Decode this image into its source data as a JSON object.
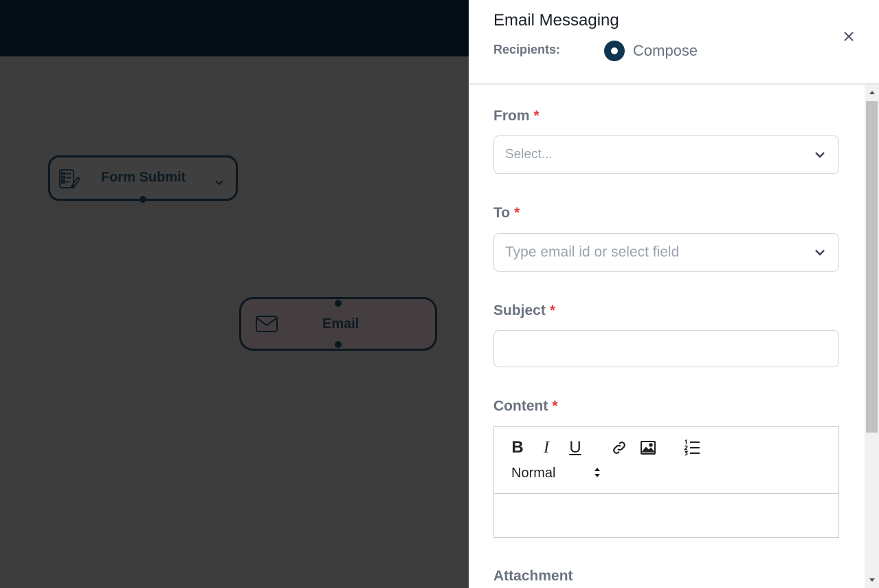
{
  "canvas": {
    "nodes": [
      {
        "label": "Form Submit",
        "icon": "form-icon"
      },
      {
        "label": "Email",
        "icon": "envelope-icon"
      }
    ]
  },
  "panel": {
    "title": "Email Messaging",
    "recipients_label": "Recipients:",
    "recipient_option": "Compose",
    "close_icon": "close-icon",
    "accent_color": "#0f3650"
  },
  "form": {
    "from": {
      "label": "From",
      "required": "*",
      "placeholder": "Select..."
    },
    "to": {
      "label": "To",
      "required": "*",
      "placeholder": "Type email id or select field"
    },
    "subject": {
      "label": "Subject",
      "required": "*",
      "value": ""
    },
    "content": {
      "label": "Content",
      "required": "*",
      "toolbar": {
        "bold": "B",
        "italic": "I",
        "underline": "U",
        "link_icon": "link-icon",
        "image_icon": "image-icon",
        "list_icon": "ordered-list-icon",
        "format": "Normal"
      }
    },
    "attachment": {
      "label": "Attachment"
    }
  },
  "colors": {
    "required": "#e53e3e",
    "label": "#6b7280",
    "topbar": "#040c14"
  }
}
